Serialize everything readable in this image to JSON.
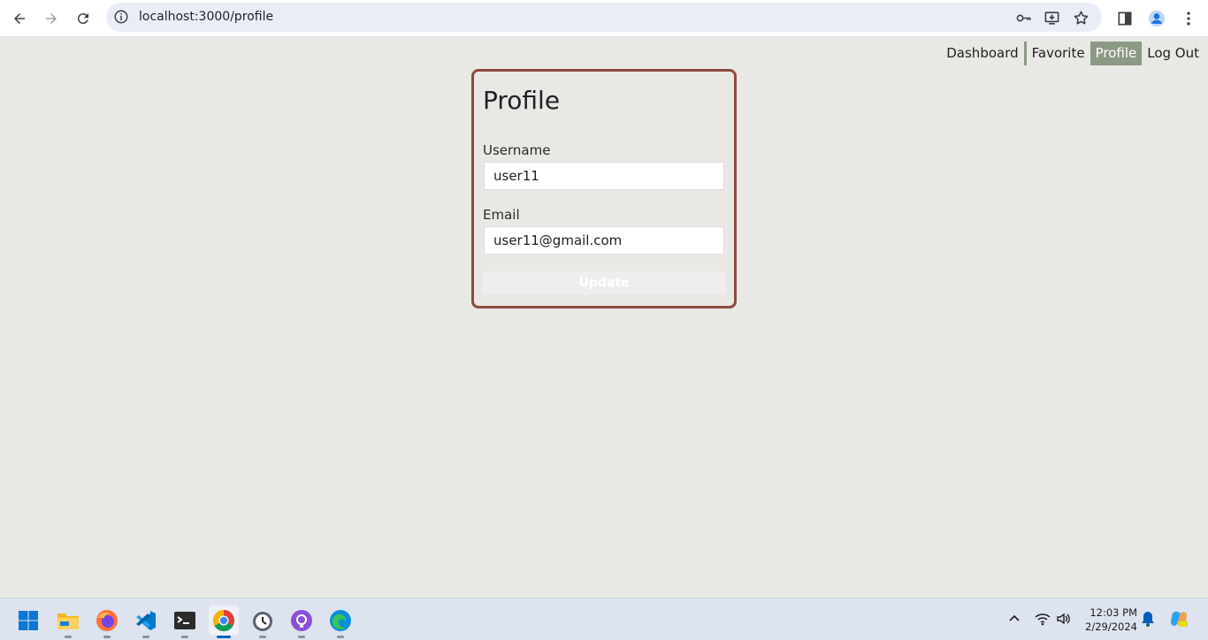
{
  "browser": {
    "url": "localhost:3000/profile"
  },
  "nav": {
    "links": [
      "Dashboard",
      "Favorite",
      "Profile",
      "Log Out"
    ],
    "active": "Profile"
  },
  "profile": {
    "title": "Profile",
    "username_label": "Username",
    "username_value": "user11",
    "email_label": "Email",
    "email_value": "user11@gmail.com",
    "update_label": "Update"
  },
  "taskbar": {
    "time": "12:03 PM",
    "date": "2/29/2024",
    "apps": [
      "start",
      "file-explorer",
      "firefox",
      "vscode",
      "terminal",
      "chrome",
      "clock",
      "github-desktop",
      "edge"
    ],
    "active_app": "chrome"
  },
  "colors": {
    "page_bg": "#e8e9e5",
    "card_border": "#8c4a3e",
    "nav_active_bg": "#8c9985"
  }
}
